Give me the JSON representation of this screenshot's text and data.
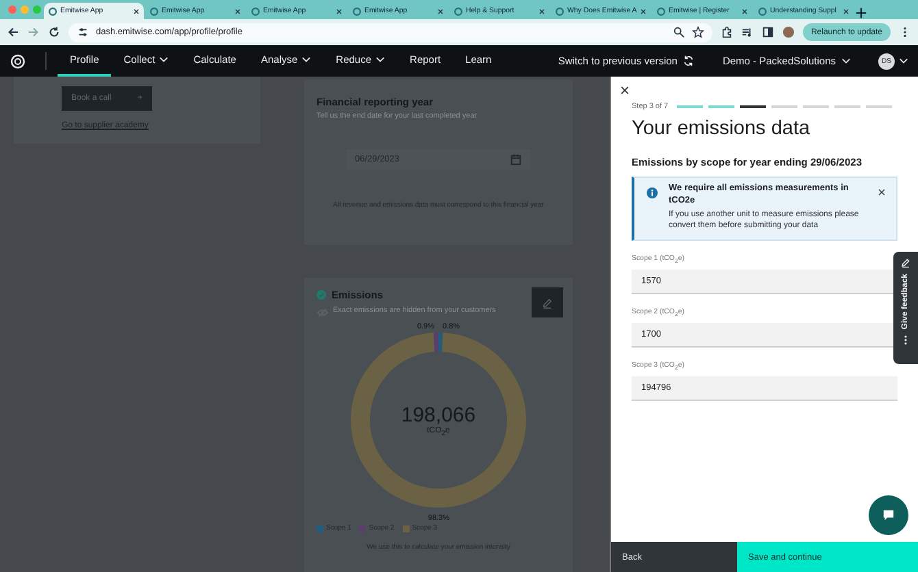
{
  "browser": {
    "tabs": [
      {
        "title": "Emitwise App",
        "selected": true
      },
      {
        "title": "Emitwise App",
        "selected": false
      },
      {
        "title": "Emitwise App",
        "selected": false
      },
      {
        "title": "Emitwise App",
        "selected": false
      },
      {
        "title": "Help & Support",
        "selected": false
      },
      {
        "title": "Why Does Emitwise A",
        "selected": false
      },
      {
        "title": "Emitwise | Register",
        "selected": false
      },
      {
        "title": "Understanding Suppl",
        "selected": false
      }
    ],
    "url": "dash.emitwise.com/app/profile/profile",
    "update_button": "Relaunch to update"
  },
  "nav": {
    "items": [
      {
        "label": "Profile",
        "selected": true,
        "has_menu": false
      },
      {
        "label": "Collect",
        "selected": false,
        "has_menu": true
      },
      {
        "label": "Calculate",
        "selected": false,
        "has_menu": false
      },
      {
        "label": "Analyse",
        "selected": false,
        "has_menu": true
      },
      {
        "label": "Reduce",
        "selected": false,
        "has_menu": true
      },
      {
        "label": "Report",
        "selected": false,
        "has_menu": false
      },
      {
        "label": "Learn",
        "selected": false,
        "has_menu": false
      }
    ],
    "switch_version": "Switch to previous version",
    "account": "Demo - PackedSolutions",
    "avatar": "DS"
  },
  "background": {
    "supplier_card": {
      "button": "Book a call",
      "button_icon": "+",
      "link": "Go to supplier academy"
    },
    "reporting_year": {
      "title": "Financial reporting year",
      "hint": "Tell us the end date for your last completed year",
      "date": "06/29/2023",
      "note": "All revenue and emissions data must correspond to this financial year"
    },
    "emissions": {
      "title": "Emissions",
      "privacy": "Exact emissions are hidden from your customers",
      "total": "198,066",
      "unit": "tCO$_{2}$e",
      "chart_data": {
        "type": "donut",
        "values": [
          0.8,
          0.9,
          98.3
        ],
        "value_labels": [
          "0.8%",
          "0.9%",
          "98.3%"
        ]
      },
      "legend": [
        {
          "label": "Scope 1",
          "color": "#245c7e"
        },
        {
          "label": "Scope 2",
          "color": "#5a3f6c"
        },
        {
          "label": "Scope 3",
          "color": "#6b6246"
        }
      ],
      "footnote": "We use this to calculate your emission intensity"
    }
  },
  "panel": {
    "step_label": "Step 3 of 7",
    "steps": [
      {
        "completed": true,
        "current": false
      },
      {
        "completed": true,
        "current": false
      },
      {
        "completed": false,
        "current": true
      },
      {
        "completed": false,
        "current": false
      },
      {
        "completed": false,
        "current": false
      },
      {
        "completed": false,
        "current": false
      },
      {
        "completed": false,
        "current": false
      }
    ],
    "title": "Your emissions data",
    "subtitle": "Emissions by scope for year ending 29/06/2023",
    "alert": {
      "title": "We require all emissions measurements in tCO2e",
      "body": "If you use another unit to measure emissions please convert them before submitting your data"
    },
    "fields": [
      {
        "label": "Scope 1 (tCO$_{2}$e)",
        "value": "1570"
      },
      {
        "label": "Scope 2 (tCO$_{2}$e)",
        "value": "1700"
      },
      {
        "label": "Scope 3 (tCO$_{2}$e)",
        "value": "194796"
      }
    ],
    "back": "Back",
    "next": "Save and continue"
  },
  "feedback": {
    "label": "Give feedback"
  }
}
